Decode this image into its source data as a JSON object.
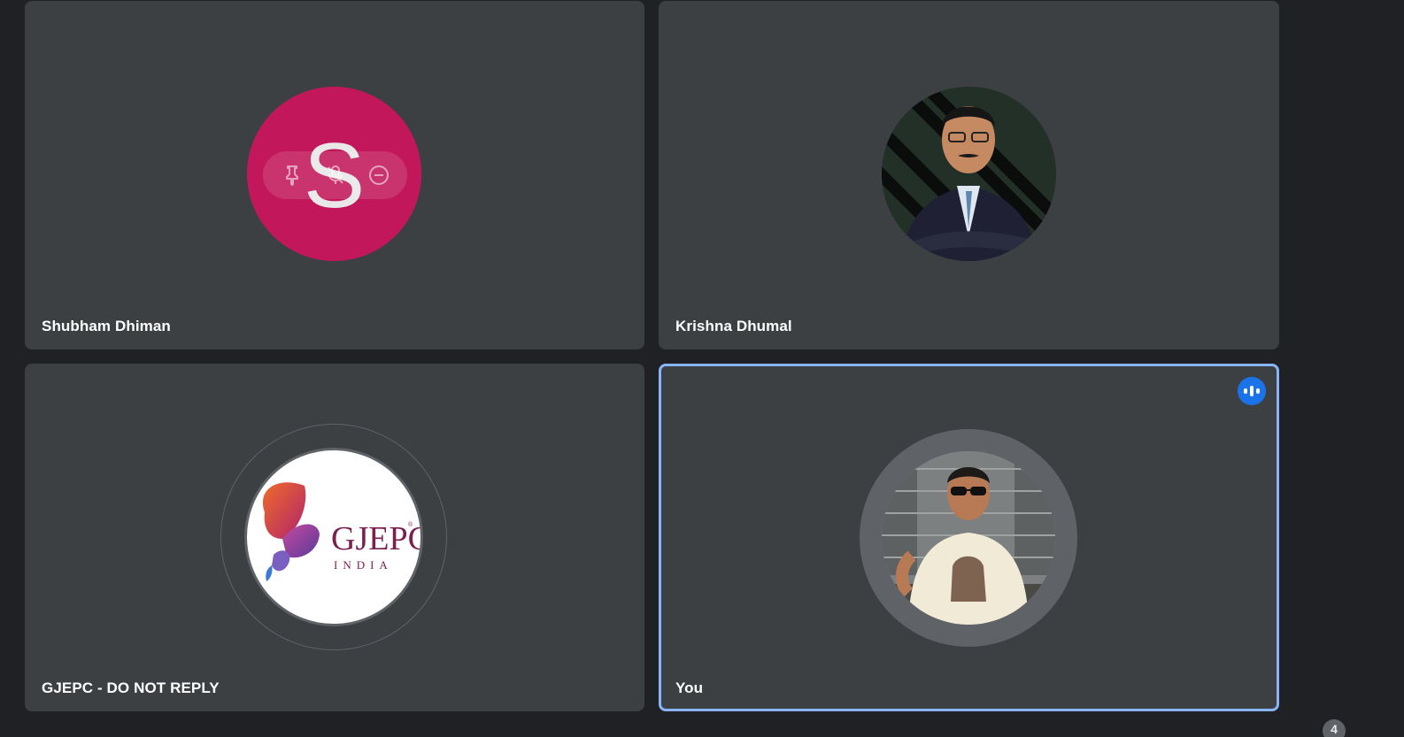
{
  "participants": [
    {
      "name": "Shubham Dhiman",
      "initial": "S",
      "avatar_color": "#c2185b"
    },
    {
      "name": "Krishna Dhumal",
      "avatar_icon": "profile-photo"
    },
    {
      "name": "GJEPC - DO NOT REPLY",
      "logo_text": "GJEPC",
      "logo_sub": "INDIA",
      "logo_mark": "®"
    },
    {
      "name": "You",
      "avatar_icon": "profile-photo",
      "speaking": true
    }
  ],
  "hover_controls": {
    "icons": [
      "pin-icon",
      "mic-off-icon",
      "remove-icon"
    ]
  },
  "overflow_count": "4",
  "colors": {
    "background": "#202124",
    "tile": "#3c4043",
    "active_border": "#8ab4f8",
    "speaking_badge": "#1a73e8"
  }
}
